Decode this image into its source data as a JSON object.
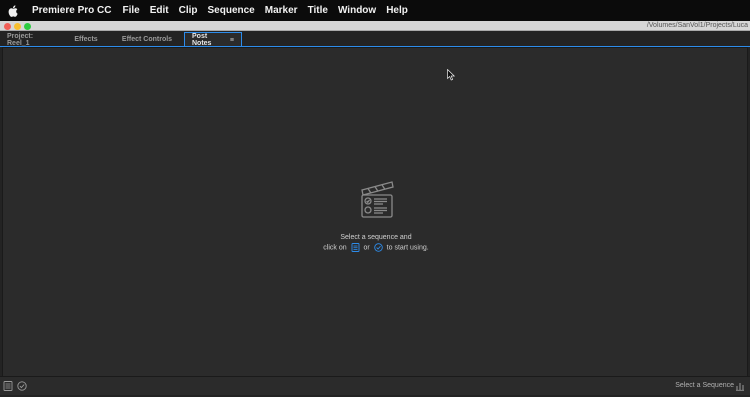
{
  "menubar": {
    "apple_icon": "apple-icon",
    "app_name": "Premiere Pro CC",
    "items": [
      "File",
      "Edit",
      "Clip",
      "Sequence",
      "Marker",
      "Title",
      "Window",
      "Help"
    ]
  },
  "titlebar": {
    "path": "/Volumes/SanVol1/Projects/Luca"
  },
  "tabs": [
    {
      "label": "Project: Reel_1"
    },
    {
      "label": "Effects"
    },
    {
      "label": "Effect Controls"
    },
    {
      "label": "Post Notes",
      "active": true
    }
  ],
  "empty_state": {
    "line1": "Select a sequence and",
    "line2_prefix": "click on",
    "line2_or": "or",
    "line2_suffix": "to start using."
  },
  "bottombar": {
    "select_sequence": "Select a Sequence"
  },
  "colors": {
    "accent": "#2d8ceb",
    "panel_bg": "#2b2b2b",
    "menubar_bg": "#0b0b0b"
  }
}
